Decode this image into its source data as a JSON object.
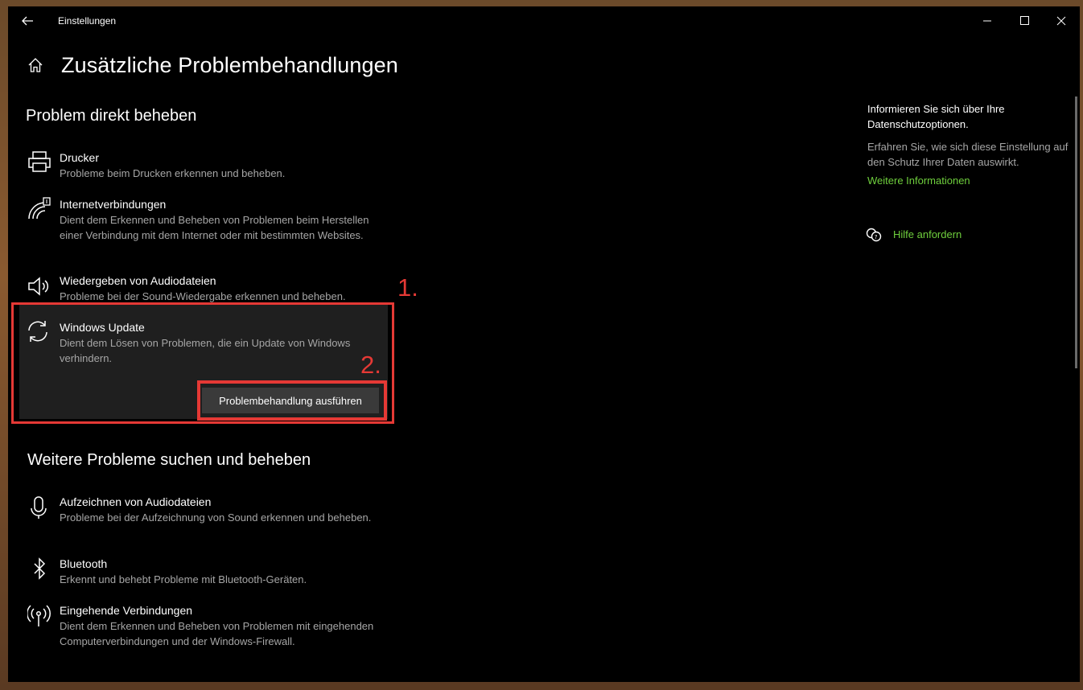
{
  "window": {
    "title": "Einstellungen"
  },
  "page": {
    "title": "Zusätzliche Problembehandlungen"
  },
  "sections": {
    "direct": "Problem direkt beheben",
    "more": "Weitere Probleme suchen und beheben"
  },
  "direct_items": [
    {
      "title": "Drucker",
      "desc": "Probleme beim Drucken erkennen und beheben.",
      "icon": "printer-icon"
    },
    {
      "title": "Internetverbindungen",
      "desc": "Dient dem Erkennen und Beheben von Problemen beim Herstellen einer Verbindung mit dem Internet oder mit bestimmten Websites.",
      "icon": "wifi-icon"
    },
    {
      "title": "Wiedergeben von Audiodateien",
      "desc": "Probleme bei der Sound-Wiedergabe erkennen und beheben.",
      "icon": "speaker-icon"
    },
    {
      "title": "Windows Update",
      "desc": "Dient dem Lösen von Problemen, die ein Update von Windows verhindern.",
      "icon": "refresh-icon",
      "button": "Problembehandlung ausführen"
    }
  ],
  "more_items": [
    {
      "title": "Aufzeichnen von Audiodateien",
      "desc": "Probleme bei der Aufzeichnung von Sound erkennen und beheben.",
      "icon": "microphone-icon"
    },
    {
      "title": "Bluetooth",
      "desc": "Erkennt und behebt Probleme mit Bluetooth-Geräten.",
      "icon": "bluetooth-icon"
    },
    {
      "title": "Eingehende Verbindungen",
      "desc": "Dient dem Erkennen und Beheben von Problemen mit eingehenden Computerverbindungen und der Windows-Firewall.",
      "icon": "antenna-icon"
    }
  ],
  "annotations": {
    "step1": "1.",
    "step2": "2.",
    "color": "#e53935"
  },
  "sidebar": {
    "privacy_title": "Informieren Sie sich über Ihre Datenschutzoptionen.",
    "privacy_desc": "Erfahren Sie, wie sich diese Einstellung auf den Schutz Ihrer Daten auswirkt.",
    "more_info_link": "Weitere Informationen",
    "help_link": "Hilfe anfordern",
    "link_color": "#6fcf3d"
  }
}
